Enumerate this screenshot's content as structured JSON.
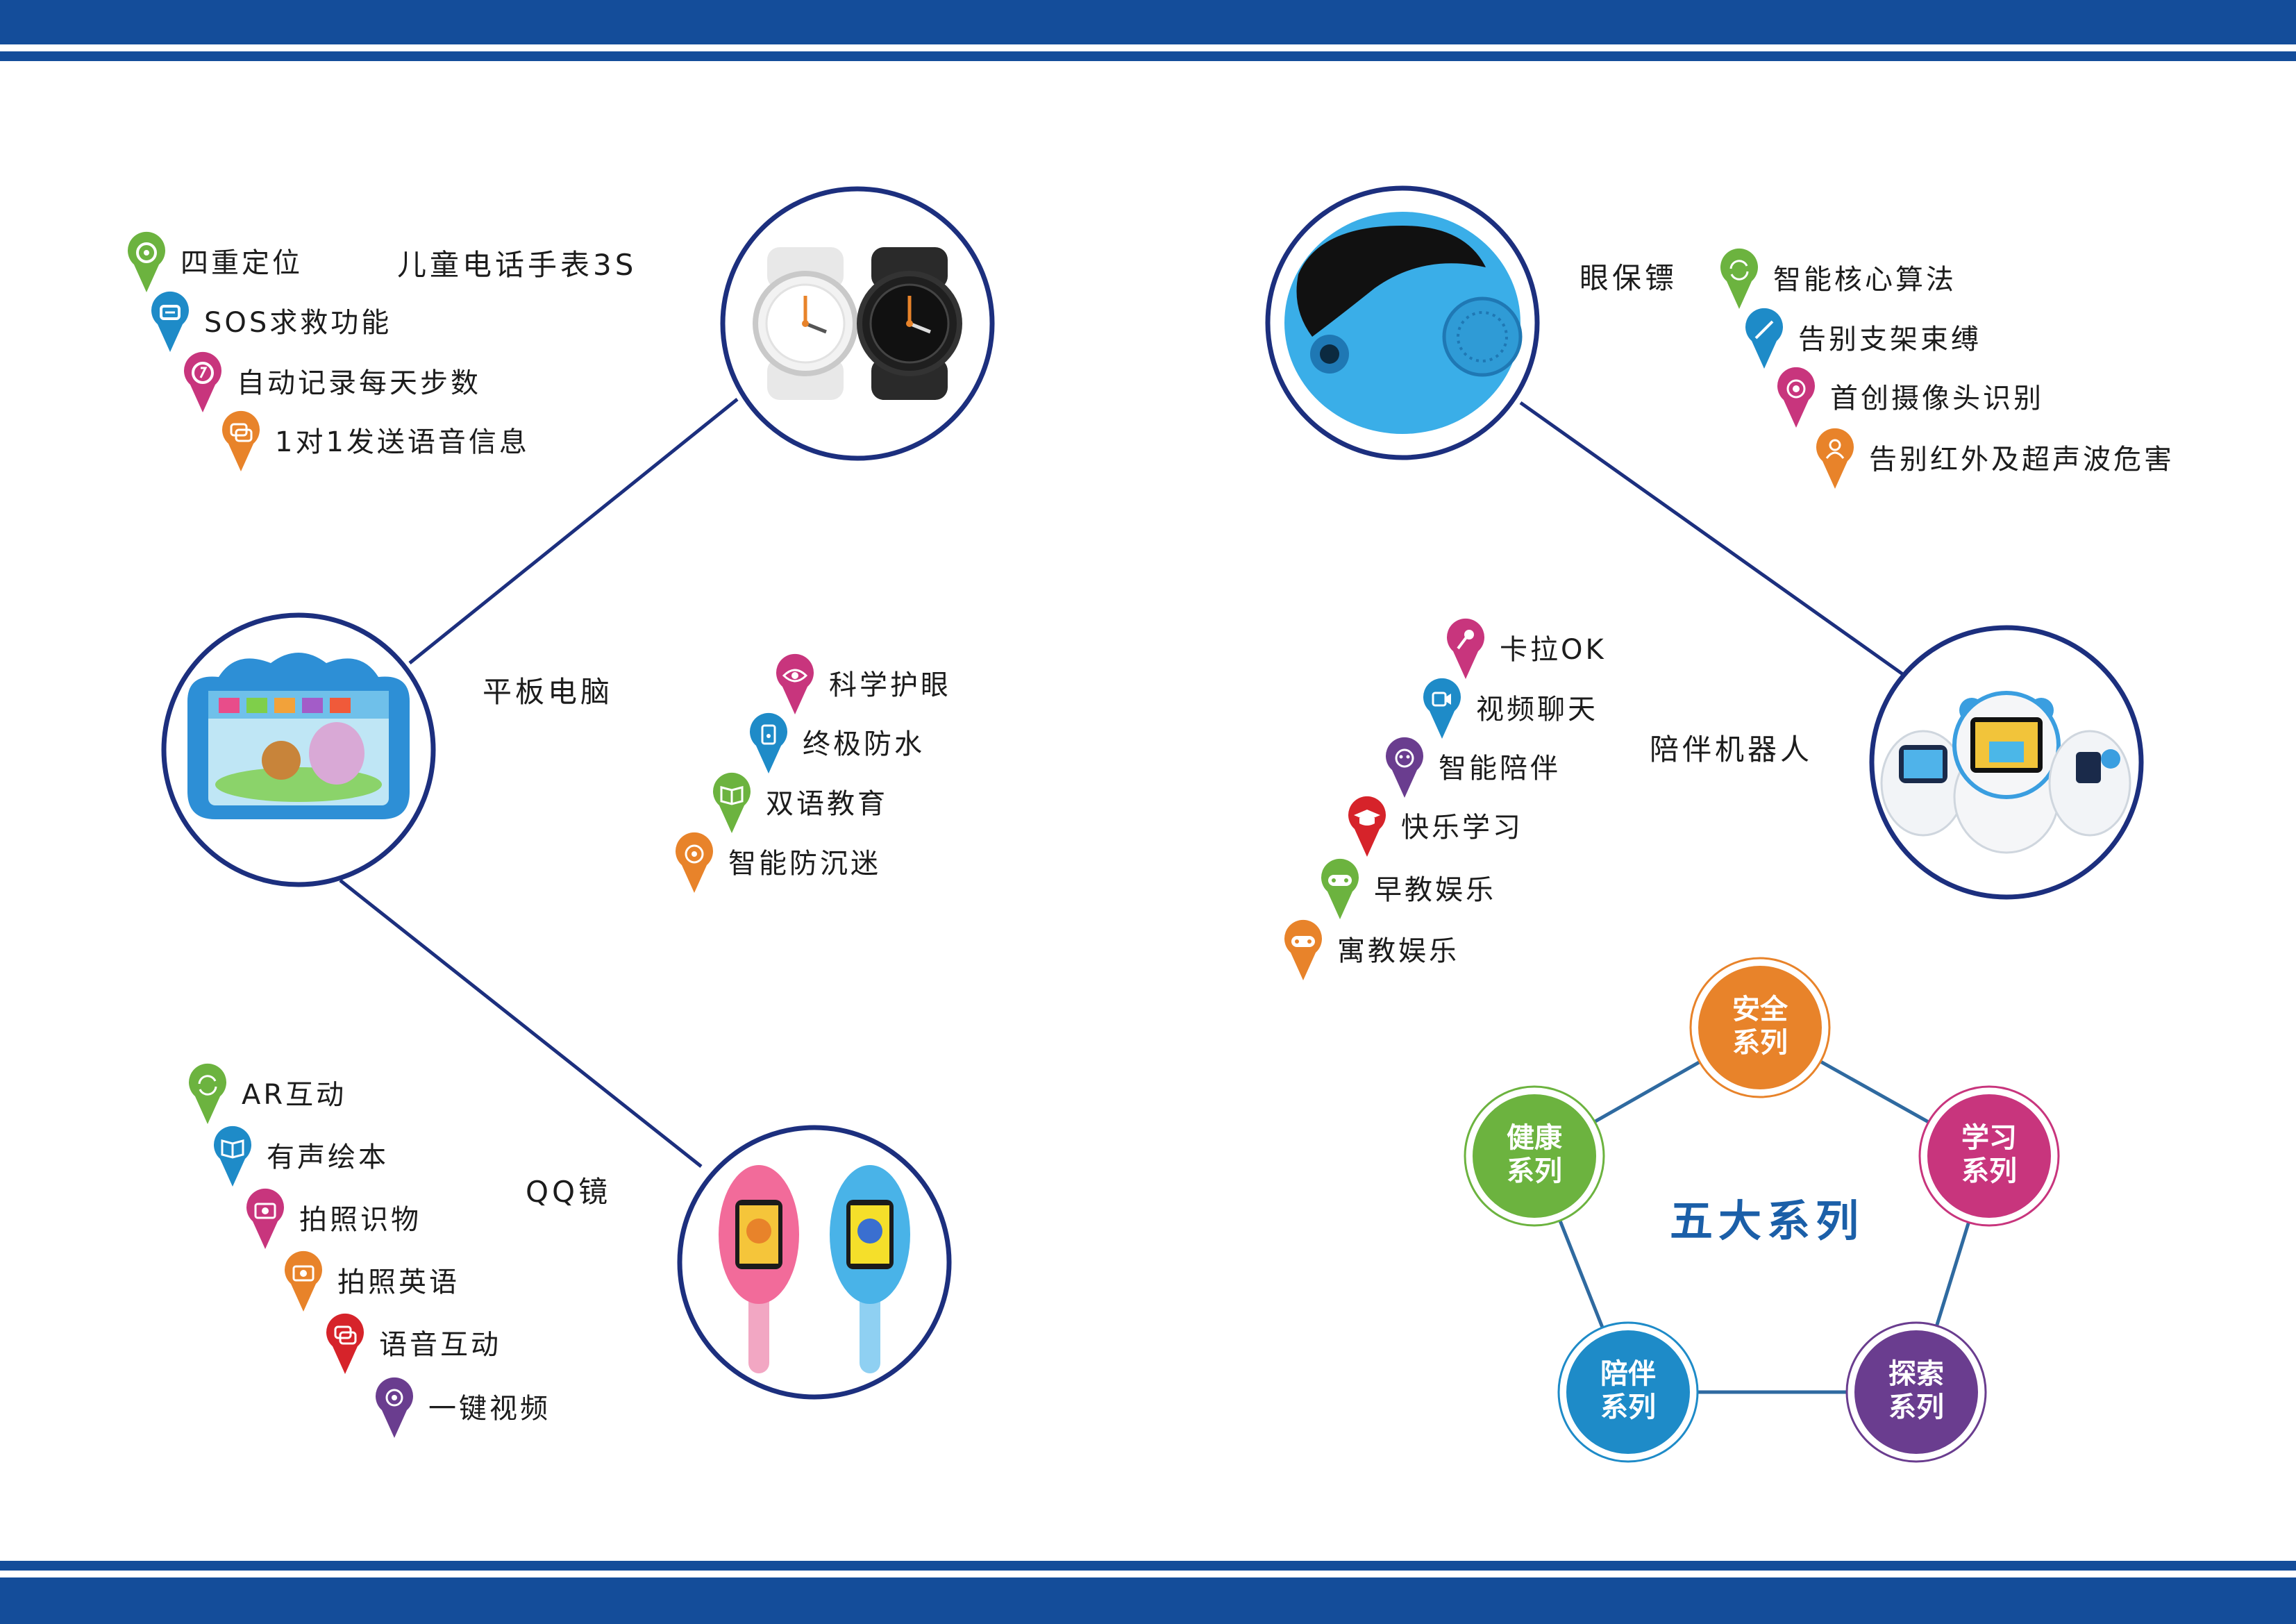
{
  "colors": {
    "band": "#144d9a",
    "line": "#1c2f7e",
    "green": "#6cb33f",
    "blue": "#1e8bc8",
    "magenta": "#c8357d",
    "orange": "#e8832a",
    "red": "#d6232a",
    "purple": "#6a3d8f",
    "title_blue": "#1b5fa8"
  },
  "products": {
    "watch": {
      "title": "儿童电话手表3S",
      "features": [
        {
          "label": "四重定位",
          "color": "green",
          "icon": "location-icon"
        },
        {
          "label": "SOS求救功能",
          "color": "blue",
          "icon": "sos-icon"
        },
        {
          "label": "自动记录每天步数",
          "color": "magenta",
          "icon": "steps-icon"
        },
        {
          "label": "1对1发送语音信息",
          "color": "orange",
          "icon": "chat-icon"
        }
      ]
    },
    "tablet": {
      "title": "平板电脑",
      "features": [
        {
          "label": "科学护眼",
          "color": "magenta",
          "icon": "eye-icon"
        },
        {
          "label": "终极防水",
          "color": "blue",
          "icon": "waterproof-icon"
        },
        {
          "label": "双语教育",
          "color": "green",
          "icon": "book-icon"
        },
        {
          "label": "智能防沉迷",
          "color": "orange",
          "icon": "timer-icon"
        }
      ]
    },
    "qq_mirror": {
      "title": "QQ镜",
      "features": [
        {
          "label": "AR互动",
          "color": "green",
          "icon": "refresh-icon"
        },
        {
          "label": "有声绘本",
          "color": "blue",
          "icon": "open-book-icon"
        },
        {
          "label": "拍照识物",
          "color": "magenta",
          "icon": "camera-icon"
        },
        {
          "label": "拍照英语",
          "color": "orange",
          "icon": "camera-icon"
        },
        {
          "label": "语音互动",
          "color": "red",
          "icon": "chat-icon"
        },
        {
          "label": "一键视频",
          "color": "purple",
          "icon": "video-icon"
        }
      ]
    },
    "eye_guard": {
      "title": "眼保镖",
      "features": [
        {
          "label": "智能核心算法",
          "color": "green",
          "icon": "refresh-icon"
        },
        {
          "label": "告别支架束缚",
          "color": "blue",
          "icon": "pen-icon"
        },
        {
          "label": "首创摄像头识别",
          "color": "magenta",
          "icon": "lens-icon"
        },
        {
          "label": "告别红外及超声波危害",
          "color": "orange",
          "icon": "person-icon"
        }
      ]
    },
    "robot": {
      "title": "陪伴机器人",
      "features": [
        {
          "label": "卡拉OK",
          "color": "magenta",
          "icon": "microphone-icon"
        },
        {
          "label": "视频聊天",
          "color": "blue",
          "icon": "video-chat-icon"
        },
        {
          "label": "智能陪伴",
          "color": "purple",
          "icon": "companion-icon"
        },
        {
          "label": "快乐学习",
          "color": "red",
          "icon": "graduation-cap-icon"
        },
        {
          "label": "早教娱乐",
          "color": "green",
          "icon": "gamepad-icon"
        },
        {
          "label": "寓教娱乐",
          "color": "orange",
          "icon": "gamepad-icon"
        }
      ]
    }
  },
  "five_series": {
    "title": "五大系列",
    "nodes": [
      {
        "line1": "安全",
        "line2": "系列",
        "color": "orange"
      },
      {
        "line1": "学习",
        "line2": "系列",
        "color": "magenta"
      },
      {
        "line1": "探索",
        "line2": "系列",
        "color": "purple"
      },
      {
        "line1": "陪伴",
        "line2": "系列",
        "color": "blue"
      },
      {
        "line1": "健康",
        "line2": "系列",
        "color": "green"
      }
    ]
  }
}
